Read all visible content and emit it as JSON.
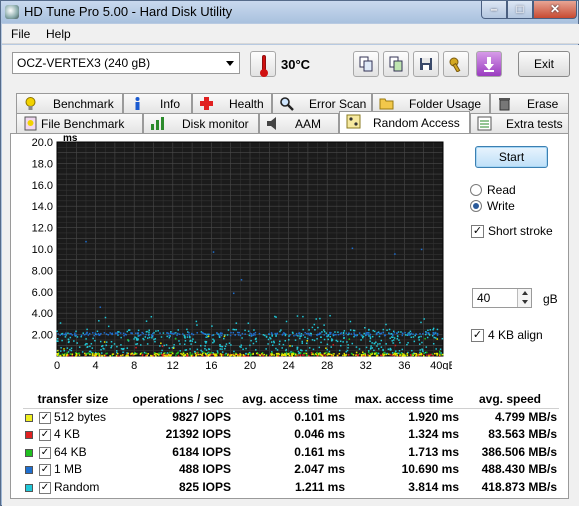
{
  "window": {
    "title": "HD Tune Pro 5.00 - Hard Disk Utility",
    "minimize": "–",
    "maximize": "□",
    "close": "✕"
  },
  "menu": {
    "file": "File",
    "help": "Help"
  },
  "toolbar": {
    "drive": "OCZ-VERTEX3 (240 gB)",
    "temperature": "30°C",
    "exit": "Exit"
  },
  "tabs_row1": [
    "Benchmark",
    "Info",
    "Health",
    "Error Scan",
    "Folder Usage",
    "Erase"
  ],
  "tabs_row2": [
    "File Benchmark",
    "Disk monitor",
    "AAM",
    "Random Access",
    "Extra tests"
  ],
  "active_tab": "Random Access",
  "controls": {
    "start": "Start",
    "read": "Read",
    "write": "Write",
    "mode_selected": "Write",
    "short_stroke": "Short stroke",
    "short_stroke_checked": true,
    "stroke_value": "40",
    "stroke_unit": "gB",
    "align": "4 KB align",
    "align_checked": true
  },
  "chart_data": {
    "type": "scatter",
    "ylabel": "ms",
    "xlabel": "gB",
    "y_ticks": [
      "20.0",
      "18.0",
      "16.0",
      "14.0",
      "12.0",
      "10.0",
      "8.00",
      "6.00",
      "4.00",
      "2.00"
    ],
    "x_ticks": [
      "0",
      "4",
      "8",
      "12",
      "16",
      "20",
      "24",
      "28",
      "32",
      "36",
      "40gB"
    ],
    "xlim": [
      0,
      40
    ],
    "ylim": [
      0,
      20
    ],
    "grid": true,
    "series": [
      {
        "name": "512 bytes",
        "color": "#e8e800",
        "typical_ms": 0.101,
        "max_ms": 1.92
      },
      {
        "name": "4 KB",
        "color": "#e02020",
        "typical_ms": 0.046,
        "max_ms": 1.324
      },
      {
        "name": "64 KB",
        "color": "#20c020",
        "typical_ms": 0.161,
        "max_ms": 1.713
      },
      {
        "name": "1 MB",
        "color": "#1e6fd0",
        "typical_ms": 2.047,
        "max_ms": 10.69
      },
      {
        "name": "Random",
        "color": "#20c8d8",
        "typical_ms": 1.211,
        "max_ms": 3.814
      }
    ]
  },
  "results": {
    "headers": [
      "transfer size",
      "operations / sec",
      "avg. access time",
      "max. access time",
      "avg. speed"
    ],
    "rows": [
      {
        "label": "512 bytes",
        "color": "#f0f020",
        "ops": "9827 IOPS",
        "avg": "0.101 ms",
        "max": "1.920 ms",
        "speed": "4.799 MB/s"
      },
      {
        "label": "4 KB",
        "color": "#e02020",
        "ops": "21392 IOPS",
        "avg": "0.046 ms",
        "max": "1.324 ms",
        "speed": "83.563 MB/s"
      },
      {
        "label": "64 KB",
        "color": "#20c020",
        "ops": "6184 IOPS",
        "avg": "0.161 ms",
        "max": "1.713 ms",
        "speed": "386.506 MB/s"
      },
      {
        "label": "1 MB",
        "color": "#1e6fd0",
        "ops": "488 IOPS",
        "avg": "2.047 ms",
        "max": "10.690 ms",
        "speed": "488.430 MB/s"
      },
      {
        "label": "Random",
        "color": "#20c8d8",
        "ops": "825 IOPS",
        "avg": "1.211 ms",
        "max": "3.814 ms",
        "speed": "418.873 MB/s"
      }
    ]
  }
}
